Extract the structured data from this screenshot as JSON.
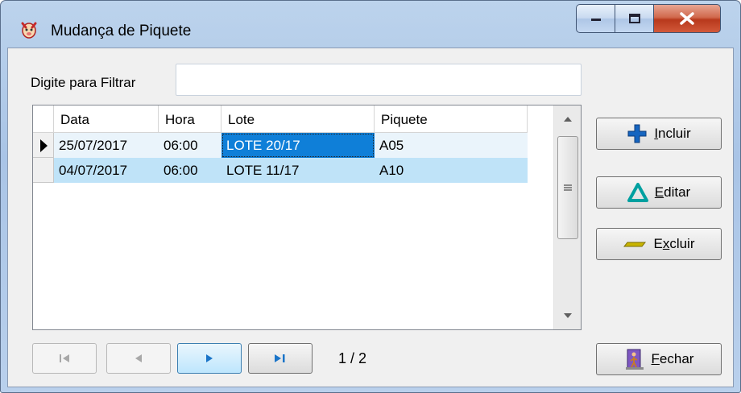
{
  "window": {
    "title": "Mudança de Piquete"
  },
  "filter": {
    "label": "Digite para Filtrar",
    "value": "",
    "placeholder": ""
  },
  "grid": {
    "columns": [
      "Data",
      "Hora",
      "Lote",
      "Piquete"
    ],
    "rows": [
      {
        "data": "25/07/2017",
        "hora": "06:00",
        "lote": "LOTE 20/17",
        "piquete": "A05",
        "current": true
      },
      {
        "data": "04/07/2017",
        "hora": "06:00",
        "lote": "LOTE 11/17",
        "piquete": "A10",
        "current": false
      }
    ],
    "selected_cell": "Lote"
  },
  "buttons": {
    "incluir": {
      "accel": "I",
      "rest": "ncluir"
    },
    "editar": {
      "accel": "E",
      "rest": "ditar"
    },
    "excluir": {
      "pre": "E",
      "accel": "x",
      "rest": "cluir"
    },
    "fechar": {
      "accel": "F",
      "rest": "echar"
    }
  },
  "navigator": {
    "page_indicator": "1 / 2"
  },
  "colors": {
    "row_selected": "#bfe3f8",
    "row_other": "#eaf4fb",
    "cell_focus": "#0f7fd8",
    "incluir_icon": "#1565c0",
    "editar_icon": "#00a0a0",
    "excluir_icon": "#b5a300"
  }
}
